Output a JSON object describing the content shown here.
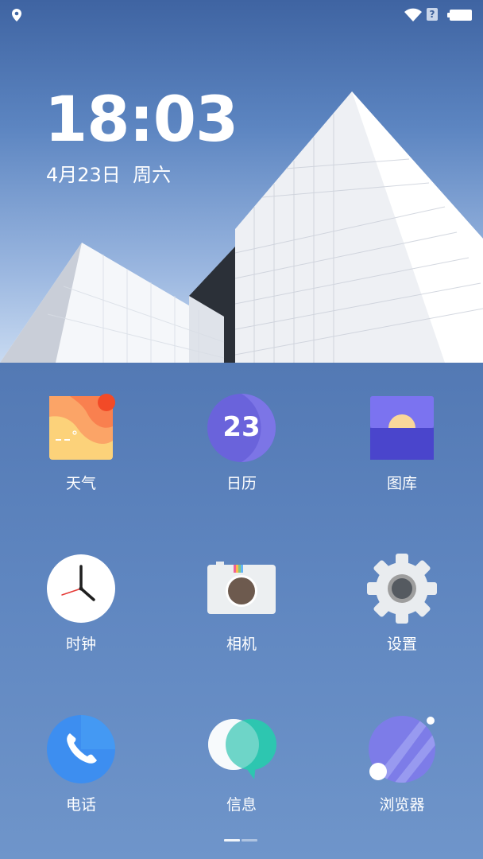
{
  "status_bar": {
    "location_icon": "location-pin-icon",
    "wifi_icon": "wifi-icon",
    "sim_label": "?",
    "battery_icon": "battery-icon"
  },
  "lockscreen": {
    "time": "18:03",
    "date": "4月23日  周六"
  },
  "apps": [
    {
      "id": "weather",
      "label": "天气",
      "icon": "weather-icon"
    },
    {
      "id": "calendar",
      "label": "日历",
      "icon": "calendar-icon",
      "badge_text": "23"
    },
    {
      "id": "gallery",
      "label": "图库",
      "icon": "gallery-icon"
    },
    {
      "id": "clock",
      "label": "时钟",
      "icon": "clock-icon"
    },
    {
      "id": "camera",
      "label": "相机",
      "icon": "camera-icon"
    },
    {
      "id": "settings",
      "label": "设置",
      "icon": "gear-icon"
    },
    {
      "id": "phone",
      "label": "电话",
      "icon": "phone-icon"
    },
    {
      "id": "messages",
      "label": "信息",
      "icon": "messages-icon"
    },
    {
      "id": "browser",
      "label": "浏览器",
      "icon": "browser-icon"
    }
  ],
  "page_indicator": {
    "pages": 2,
    "current": 1
  },
  "colors": {
    "calendar_purple": "#6a63db",
    "gallery_purple": "#6c64e0",
    "phone_blue": "#3d8ef0",
    "messages_teal": "#2dc6b0",
    "browser_violet": "#7d7ce8"
  }
}
